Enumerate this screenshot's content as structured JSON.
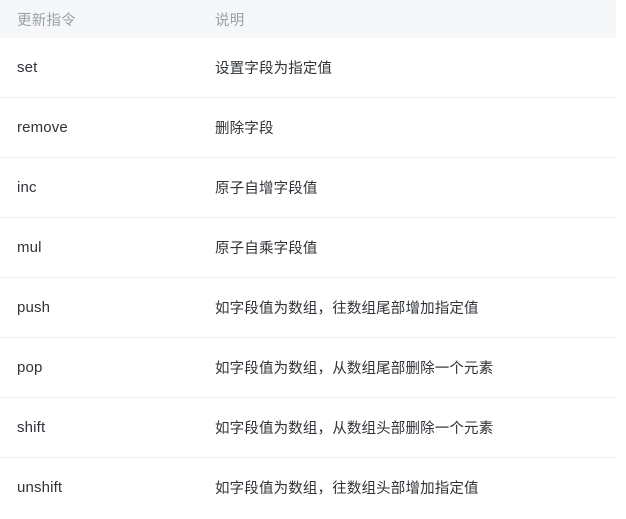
{
  "table": {
    "columns": [
      {
        "key": "command",
        "label": "更新指令"
      },
      {
        "key": "description",
        "label": "说明"
      }
    ],
    "rows": [
      {
        "command": "set",
        "description": "设置字段为指定值"
      },
      {
        "command": "remove",
        "description": "删除字段"
      },
      {
        "command": "inc",
        "description": "原子自增字段值"
      },
      {
        "command": "mul",
        "description": "原子自乘字段值"
      },
      {
        "command": "push",
        "description": "如字段值为数组，往数组尾部增加指定值"
      },
      {
        "command": "pop",
        "description": "如字段值为数组，从数组尾部删除一个元素"
      },
      {
        "command": "shift",
        "description": "如字段值为数组，从数组头部删除一个元素"
      },
      {
        "command": "unshift",
        "description": "如字段值为数组，往数组头部增加指定值"
      }
    ]
  },
  "colors": {
    "header_background": "#f6f7f9",
    "header_text": "#9a9ea6",
    "body_text": "#2f3337",
    "row_divider": "#eceef0",
    "page_background": "#ffffff"
  }
}
